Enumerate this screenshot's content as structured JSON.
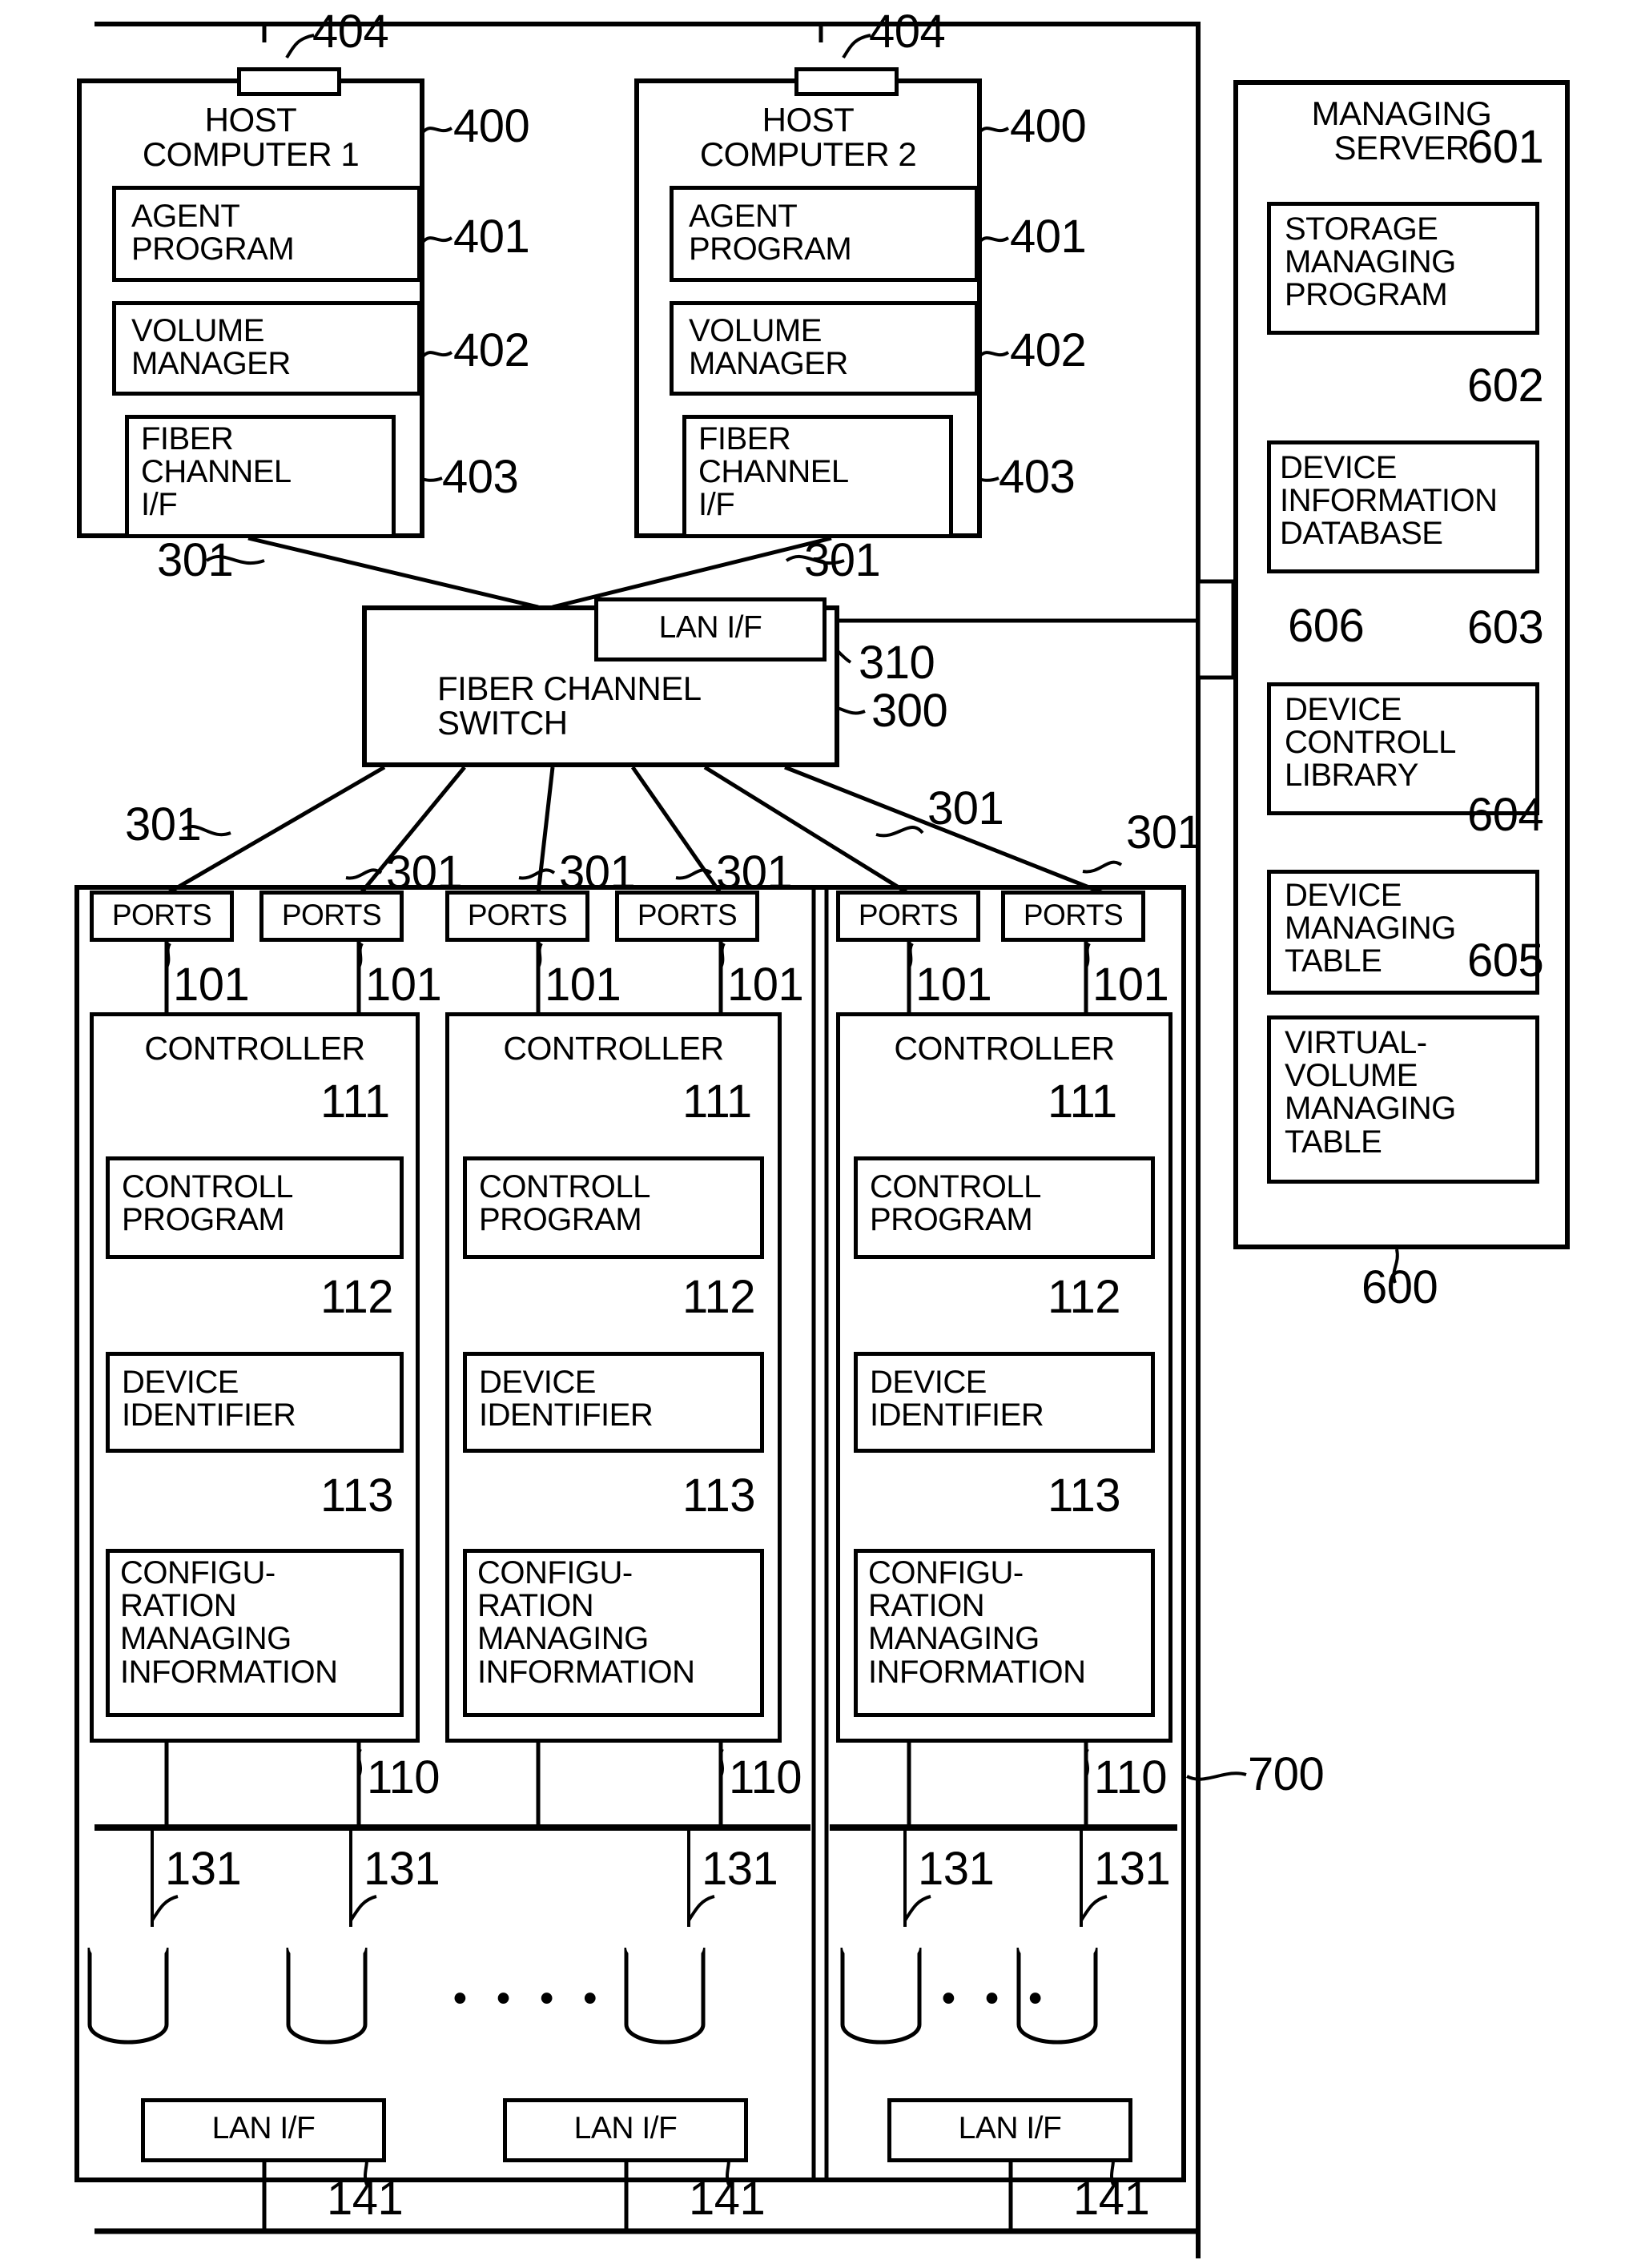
{
  "figure": {
    "title": "Storage area network system block diagram",
    "hosts": [
      {
        "name": "HOST\nCOMPUTER 1",
        "ref": "400",
        "port_ref": "404",
        "fc_ref": "301",
        "blocks": [
          {
            "label": "AGENT\nPROGRAM",
            "ref": "401"
          },
          {
            "label": "VOLUME\nMANAGER",
            "ref": "402"
          },
          {
            "label": "FIBER\nCHANNEL\nI/F",
            "ref": "403"
          }
        ]
      },
      {
        "name": "HOST\nCOMPUTER 2",
        "ref": "400",
        "port_ref": "404",
        "fc_ref": "301",
        "blocks": [
          {
            "label": "AGENT\nPROGRAM",
            "ref": "401"
          },
          {
            "label": "VOLUME\nMANAGER",
            "ref": "402"
          },
          {
            "label": "FIBER\nCHANNEL\nI/F",
            "ref": "403"
          }
        ]
      }
    ],
    "switch": {
      "name": "FIBER CHANNEL\nSWITCH",
      "ref": "300",
      "lan_if_label": "LAN I/F",
      "lan_if_ref": "310",
      "link_refs": [
        "301",
        "301",
        "301",
        "301",
        "301",
        "301"
      ]
    },
    "managing_server": {
      "name": "MANAGING\nSERVER",
      "ref": "600",
      "lan_if_ref": "606",
      "blocks": [
        {
          "label": "STORAGE\nMANAGING\nPROGRAM",
          "ref": "601"
        },
        {
          "label": "DEVICE\nINFORMATION\nDATABASE",
          "ref": "602"
        },
        {
          "label": "DEVICE\nCONTROLL\nLIBRARY",
          "ref": "603"
        },
        {
          "label": "DEVICE\nMANAGING\nTABLE",
          "ref": "604"
        },
        {
          "label": "VIRTUAL-\nVOLUME\nMANAGING\nTABLE",
          "ref": "605"
        }
      ]
    },
    "storage_system": {
      "ref": "700",
      "ports_label": "PORTS",
      "port_ref": "101",
      "disk_ref": "131",
      "bus_ref": "110",
      "lan_if_label": "LAN I/F",
      "lan_if_ref": "141",
      "ellipsis_4": "• • • •",
      "ellipsis_3": "• • •",
      "units": [
        {
          "controller": "CONTROLLER",
          "ports": [
            "PORTS",
            "PORTS"
          ],
          "blocks": [
            {
              "label": "CONTROLL\nPROGRAM",
              "ref": "111"
            },
            {
              "label": "DEVICE\nIDENTIFIER",
              "ref": "112"
            },
            {
              "label": "CONFIGU-\nRATION\nMANAGING\nINFORMATION",
              "ref": "113"
            }
          ]
        },
        {
          "controller": "CONTROLLER",
          "ports": [
            "PORTS",
            "PORTS"
          ],
          "blocks": [
            {
              "label": "CONTROLL\nPROGRAM",
              "ref": "111"
            },
            {
              "label": "DEVICE\nIDENTIFIER",
              "ref": "112"
            },
            {
              "label": "CONFIGU-\nRATION\nMANAGING\nINFORMATION",
              "ref": "113"
            }
          ]
        },
        {
          "controller": "CONTROLLER",
          "ports": [
            "PORTS",
            "PORTS"
          ],
          "blocks": [
            {
              "label": "CONTROLL\nPROGRAM",
              "ref": "111"
            },
            {
              "label": "DEVICE\nIDENTIFIER",
              "ref": "112"
            },
            {
              "label": "CONFIGU-\nRATION\nMANAGING\nINFORMATION",
              "ref": "113"
            }
          ]
        }
      ]
    },
    "refs": {
      "r404a": "404",
      "r404b": "404",
      "r400a": "400",
      "r400b": "400",
      "r401a": "401",
      "r401b": "401",
      "r402a": "402",
      "r402b": "402",
      "r403a": "403",
      "r403b": "403",
      "r301_h1": "301",
      "r301_h2": "301",
      "r310": "310",
      "r300": "300",
      "r301_s1": "301",
      "r301_s2": "301",
      "r301_s3": "301",
      "r301_s4": "301",
      "r301_s5": "301",
      "r301_s6": "301",
      "r101_1": "101",
      "r101_2": "101",
      "r101_3": "101",
      "r101_4": "101",
      "r101_5": "101",
      "r101_6": "101",
      "r111_1": "111",
      "r111_2": "111",
      "r111_3": "111",
      "r112_1": "112",
      "r112_2": "112",
      "r112_3": "112",
      "r113_1": "113",
      "r113_2": "113",
      "r113_3": "113",
      "r110_1": "110",
      "r110_2": "110",
      "r110_3": "110",
      "r131_1": "131",
      "r131_2": "131",
      "r131_3": "131",
      "r131_4": "131",
      "r131_5": "131",
      "r141_1": "141",
      "r141_2": "141",
      "r141_3": "141",
      "r600": "600",
      "r601": "601",
      "r602": "602",
      "r603": "603",
      "r604": "604",
      "r605": "605",
      "r606": "606",
      "r700": "700"
    }
  }
}
